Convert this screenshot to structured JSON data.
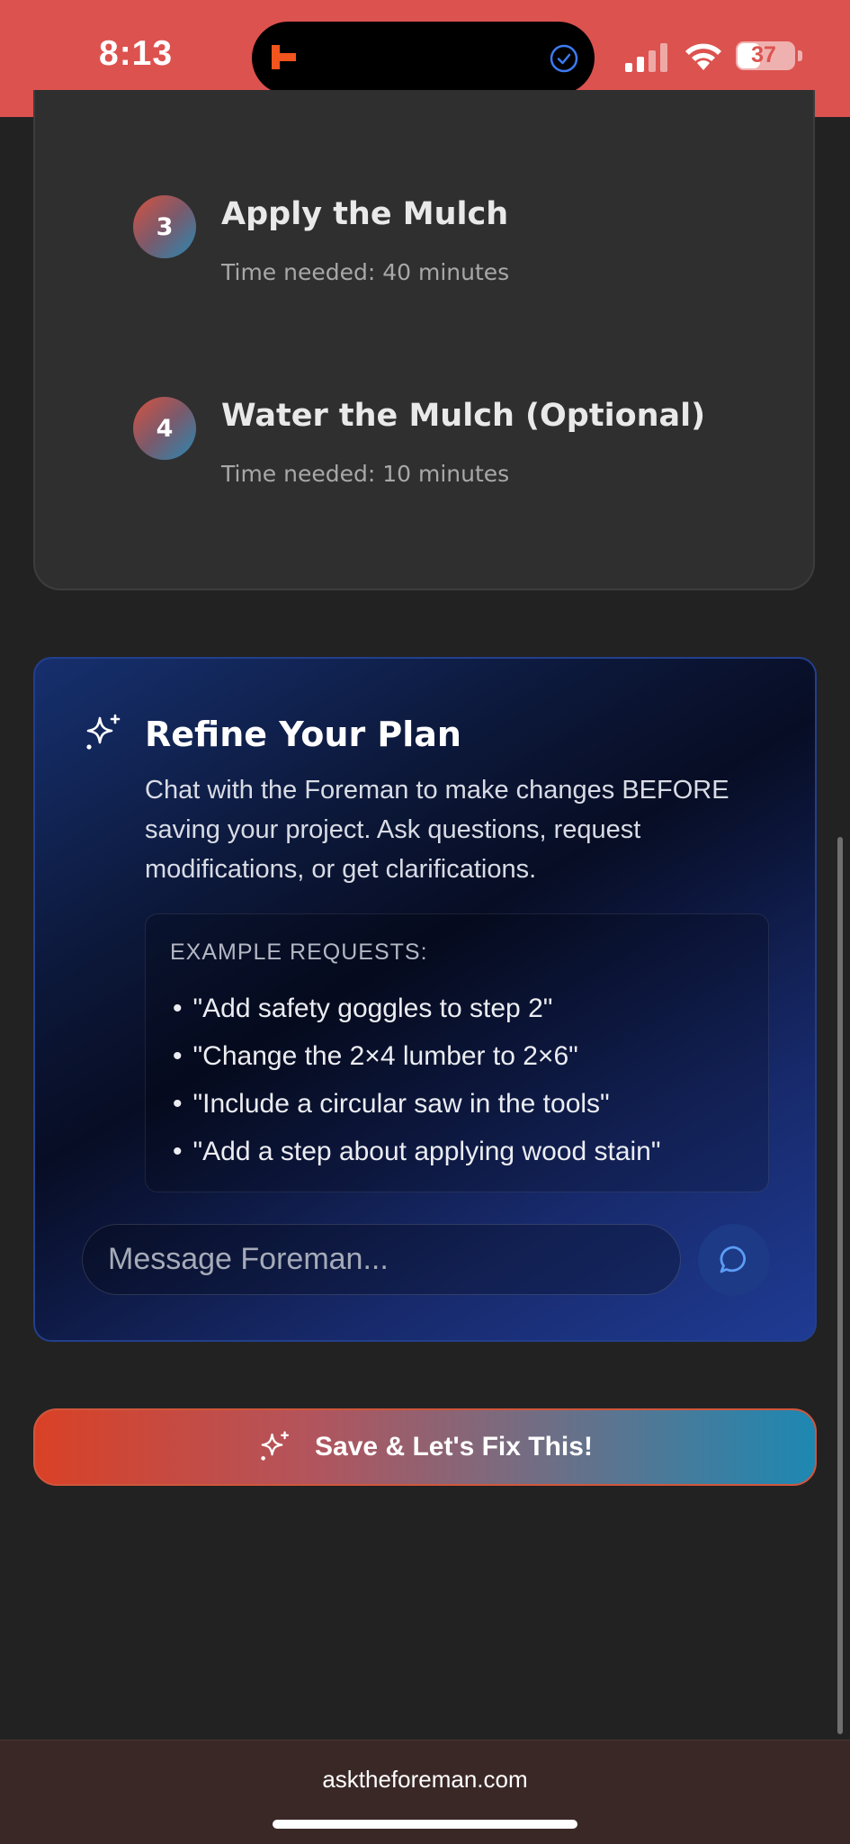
{
  "status_bar": {
    "time": "8:13",
    "battery_level": "37",
    "background_color": "#dc524f",
    "icons": [
      "app-icon",
      "check-circle-icon",
      "signal-icon",
      "wifi-icon",
      "battery-icon"
    ]
  },
  "steps": [
    {
      "number": "3",
      "title": "Apply the Mulch",
      "time": "Time needed: 40 minutes"
    },
    {
      "number": "4",
      "title": "Water the Mulch (Optional)",
      "time": "Time needed: 10 minutes"
    }
  ],
  "refine": {
    "title": "Refine Your Plan",
    "description": "Chat with the Foreman to make changes BEFORE saving your project. Ask questions, request modifications, or get clarifications.",
    "examples_heading": "EXAMPLE REQUESTS:",
    "examples": [
      "\"Add safety goggles to step 2\"",
      "\"Change the 2×4 lumber to 2×6\"",
      "\"Include a circular saw in the tools\"",
      "\"Add a step about applying wood stain\""
    ],
    "input_placeholder": "Message Foreman...",
    "send_icon": "chat-bubble-icon"
  },
  "save_button": {
    "label": "Save & Let's Fix This!",
    "icon": "sparkle-icon"
  },
  "browser": {
    "url": "asktheforeman.com"
  },
  "colors": {
    "accent_orange": "#d94126",
    "accent_blue": "#1d88b2",
    "panel_blue": "#1f3b93",
    "page_background": "#222222"
  }
}
